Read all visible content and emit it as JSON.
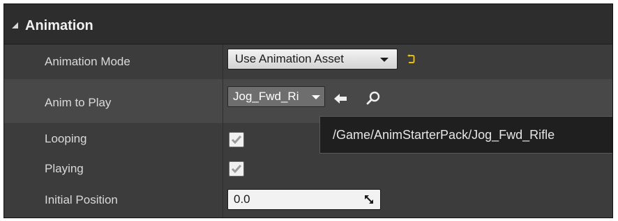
{
  "section": {
    "title": "Animation"
  },
  "properties": {
    "animation_mode": {
      "label": "Animation Mode",
      "value": "Use Animation Asset"
    },
    "anim_to_play": {
      "label": "Anim to Play",
      "value": "Jog_Fwd_Ri"
    },
    "looping": {
      "label": "Looping",
      "checked": true
    },
    "playing": {
      "label": "Playing",
      "checked": true
    },
    "initial_position": {
      "label": "Initial Position",
      "value": "0.0"
    }
  },
  "tooltip": {
    "text": "/Game/AnimStarterPack/Jog_Fwd_Rifle"
  },
  "icons": {
    "section_toggle": "collapse-triangle-icon",
    "reset": "reset-to-default-icon",
    "use_selected": "left-arrow-icon",
    "browse": "search-icon",
    "checkbox": "checkmark-icon",
    "spin": "drag-spinner-icon"
  },
  "colors": {
    "panel_bg": "#3c3c3c",
    "header_bg": "#2d2d2d",
    "reset_arrow": "#e8c000",
    "tooltip_bg": "#1f1f1f"
  }
}
